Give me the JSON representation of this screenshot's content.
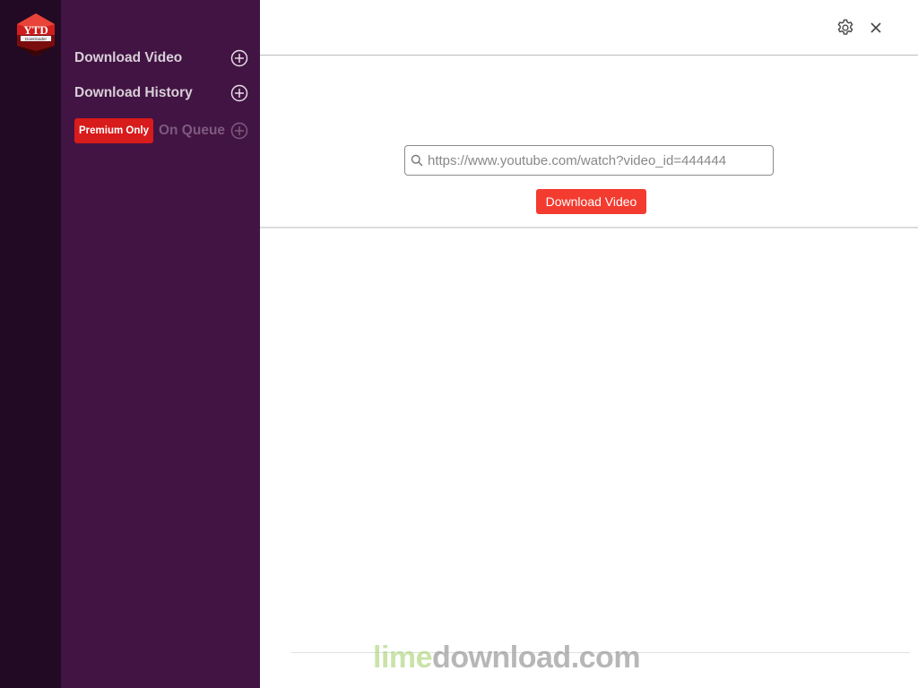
{
  "app": {
    "logo_text": "YTD",
    "logo_subtext": "Downloader"
  },
  "sidebar": {
    "items": [
      {
        "label": "Download Video"
      },
      {
        "label": "Download History"
      },
      {
        "label": "On Queue",
        "badge": "Premium Only",
        "disabled": true
      }
    ]
  },
  "toolbar": {
    "settings_icon": "gear-icon",
    "close_icon": "close-icon"
  },
  "main": {
    "url_placeholder": "https://www.youtube.com/watch?video_id=444444",
    "url_value": "",
    "download_button": "Download Video"
  },
  "watermark": {
    "part1": "lime",
    "part2": "download.com"
  },
  "colors": {
    "rail": "#220a24",
    "sidebar": "#421443",
    "accent": "#f33b2f",
    "premium_badge": "#d81b1b"
  }
}
